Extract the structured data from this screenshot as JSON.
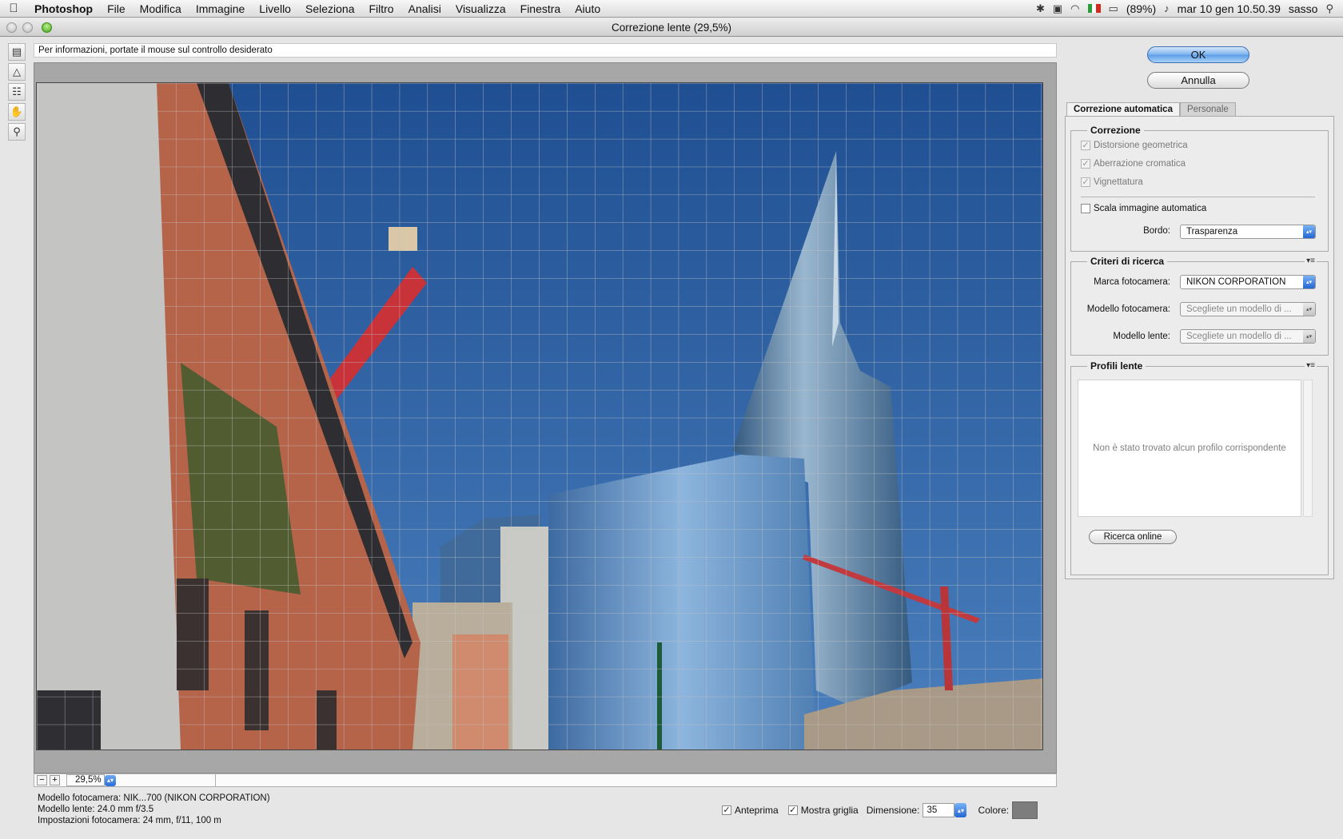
{
  "menubar": {
    "app_name": "Photoshop",
    "items": [
      "File",
      "Modifica",
      "Immagine",
      "Livello",
      "Seleziona",
      "Filtro",
      "Analisi",
      "Visualizza",
      "Finestra",
      "Aiuto"
    ],
    "battery": "(89%)",
    "datetime": "mar 10 gen  10.50.39",
    "user": "sasso"
  },
  "window": {
    "title": "Correzione lente (29,5%)"
  },
  "infoline": "Per informazioni, portate il mouse sul controllo desiderato",
  "zoom": {
    "minus": "−",
    "plus": "+",
    "value": "29,5%"
  },
  "camera_info": {
    "camera_model": "Modello fotocamera: NIK...700 (NIKON CORPORATION)",
    "lens_model": "Modello lente: 24.0 mm f/3.5",
    "camera_settings": "Impostazioni fotocamera: 24 mm, f/11, 100 m"
  },
  "bottom": {
    "preview_label": "Anteprima",
    "preview_checked": true,
    "grid_label": "Mostra griglia",
    "grid_checked": true,
    "size_label": "Dimensione:",
    "size_value": "35",
    "color_label": "Colore:",
    "color_value": "#7d7d7d"
  },
  "buttons": {
    "ok": "OK",
    "cancel": "Annulla"
  },
  "tabs": {
    "auto": "Correzione automatica",
    "custom": "Personale"
  },
  "correction": {
    "legend": "Correzione",
    "geometric": "Distorsione geometrica",
    "chromatic": "Aberrazione cromatica",
    "vignetting": "Vignettatura",
    "autoscale": "Scala immagine automatica",
    "edge_label": "Bordo:",
    "edge_value": "Trasparenza"
  },
  "search": {
    "legend": "Criteri di ricerca",
    "make_label": "Marca fotocamera:",
    "make_value": "NIKON CORPORATION",
    "camera_label": "Modello fotocamera:",
    "camera_value": "Scegliete un modello di ...",
    "lens_label": "Modello lente:",
    "lens_value": "Scegliete un modello di ..."
  },
  "profiles": {
    "legend": "Profili lente",
    "empty_message": "Non è stato trovato alcun profilo corrispondente",
    "search_online": "Ricerca online"
  },
  "icons": {
    "tools": [
      "remove-distortion-icon",
      "straighten-icon",
      "move-grid-icon",
      "hand-icon",
      "zoom-icon"
    ]
  },
  "colors": {
    "sky": "#2f62a3",
    "grid_line": "#b8b8b8",
    "accent_blue": "#2a6fd8"
  }
}
